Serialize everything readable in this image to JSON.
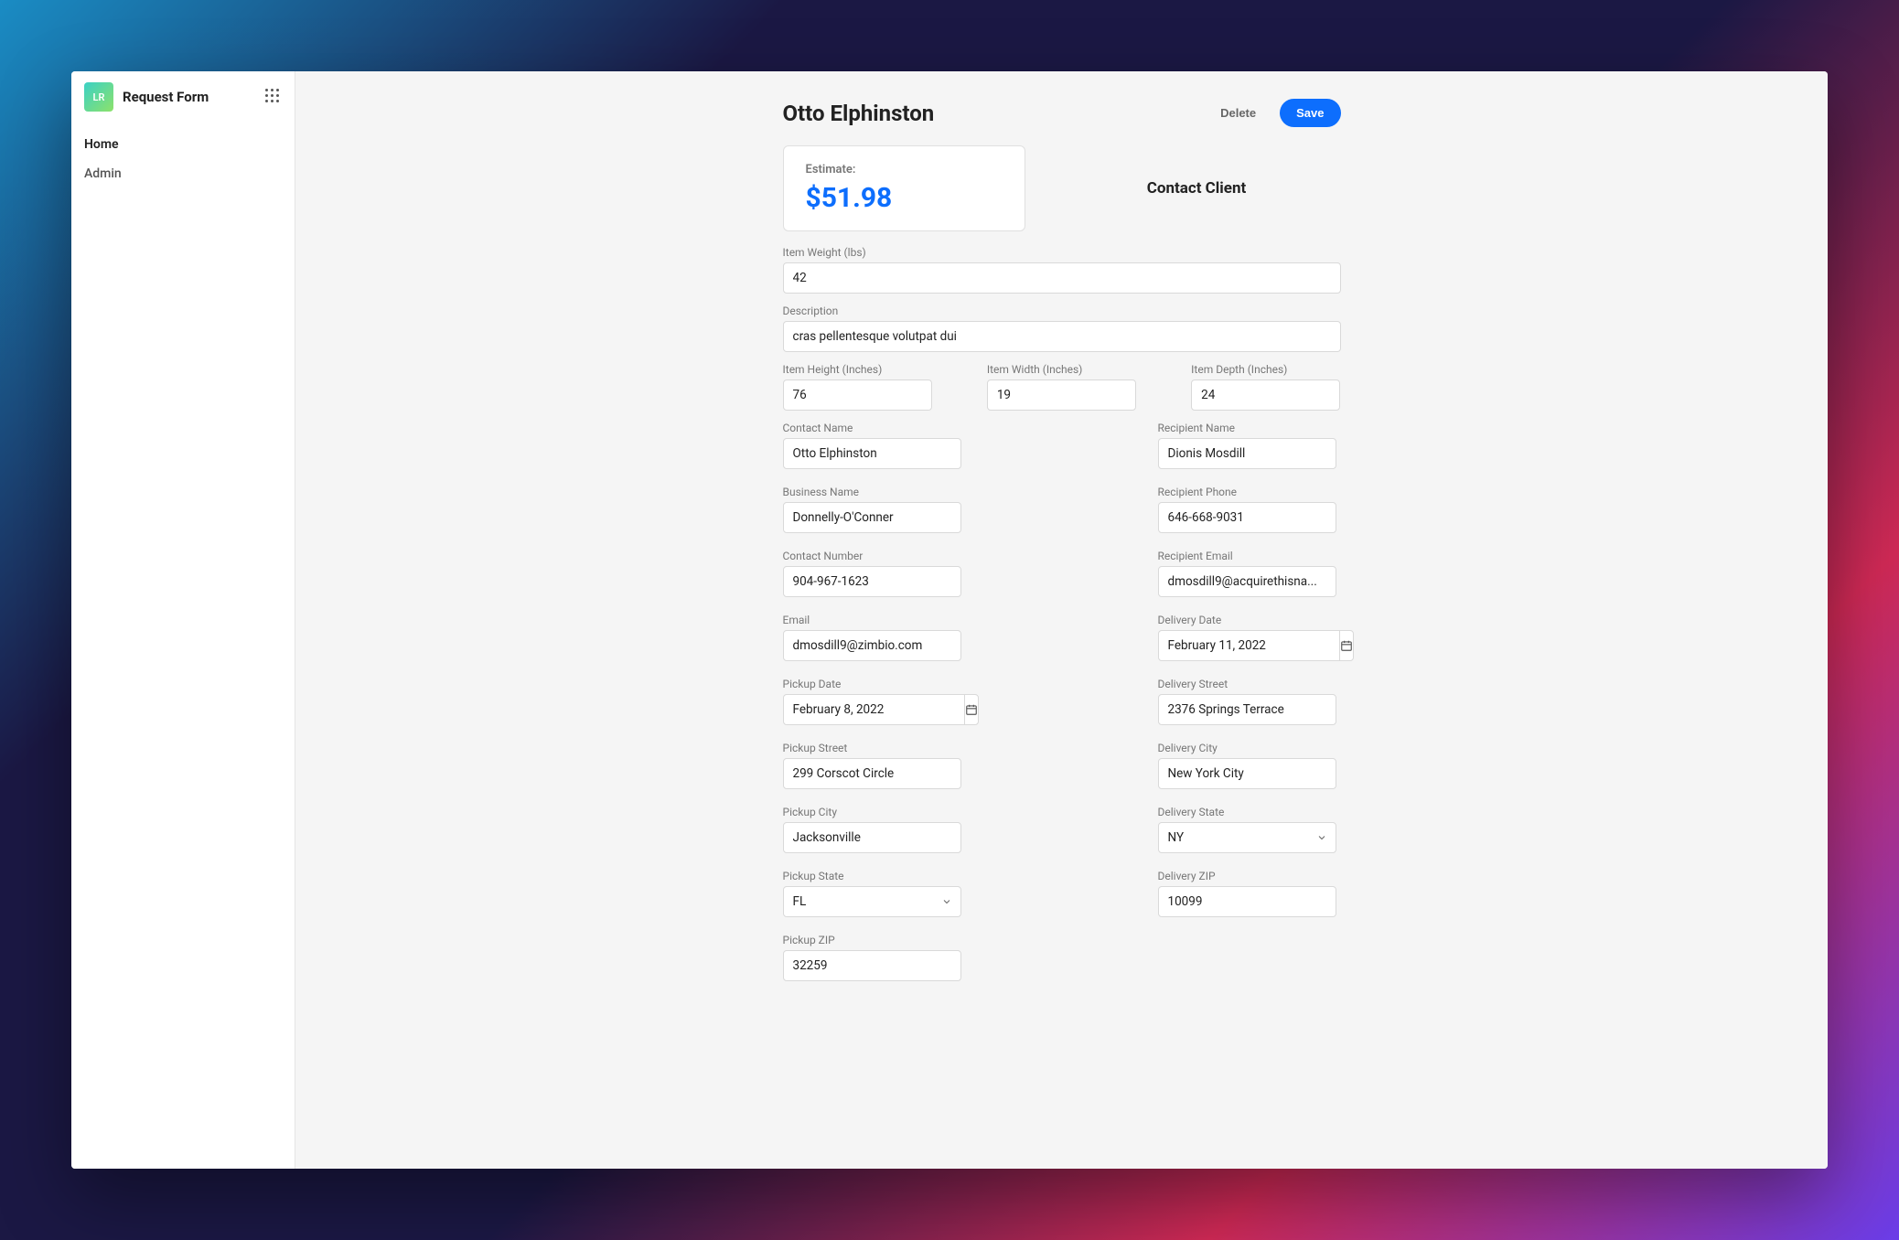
{
  "app": {
    "logo_initials": "LR",
    "title": "Request Form"
  },
  "nav": {
    "items": [
      {
        "label": "Home"
      },
      {
        "label": "Admin"
      }
    ]
  },
  "header": {
    "title": "Otto Elphinston",
    "delete_label": "Delete",
    "save_label": "Save"
  },
  "estimate": {
    "label": "Estimate:",
    "value": "$51.98"
  },
  "contact_client_label": "Contact Client",
  "fields": {
    "item_weight": {
      "label": "Item Weight (lbs)",
      "value": "42"
    },
    "description": {
      "label": "Description",
      "value": "cras pellentesque volutpat dui"
    },
    "item_height": {
      "label": "Item Height (Inches)",
      "value": "76"
    },
    "item_width": {
      "label": "Item Width (Inches)",
      "value": "19"
    },
    "item_depth": {
      "label": "Item Depth (Inches)",
      "value": "24"
    },
    "contact_name": {
      "label": "Contact Name",
      "value": "Otto Elphinston"
    },
    "business_name": {
      "label": "Business Name",
      "value": "Donnelly-O'Conner"
    },
    "contact_number": {
      "label": "Contact Number",
      "value": "904-967-1623"
    },
    "email": {
      "label": "Email",
      "value": "dmosdill9@zimbio.com"
    },
    "pickup_date": {
      "label": "Pickup Date",
      "value": "February 8, 2022"
    },
    "pickup_street": {
      "label": "Pickup Street",
      "value": "299 Corscot Circle"
    },
    "pickup_city": {
      "label": "Pickup City",
      "value": "Jacksonville"
    },
    "pickup_state": {
      "label": "Pickup State",
      "value": "FL"
    },
    "pickup_zip": {
      "label": "Pickup ZIP",
      "value": "32259"
    },
    "recipient_name": {
      "label": "Recipient Name",
      "value": "Dionis Mosdill"
    },
    "recipient_phone": {
      "label": "Recipient Phone",
      "value": "646-668-9031"
    },
    "recipient_email": {
      "label": "Recipient Email",
      "value": "dmosdill9@acquirethisna..."
    },
    "delivery_date": {
      "label": "Delivery Date",
      "value": "February 11, 2022"
    },
    "delivery_street": {
      "label": "Delivery Street",
      "value": "2376 Springs Terrace"
    },
    "delivery_city": {
      "label": "Delivery City",
      "value": "New York City"
    },
    "delivery_state": {
      "label": "Delivery State",
      "value": "NY"
    },
    "delivery_zip": {
      "label": "Delivery ZIP",
      "value": "10099"
    }
  }
}
